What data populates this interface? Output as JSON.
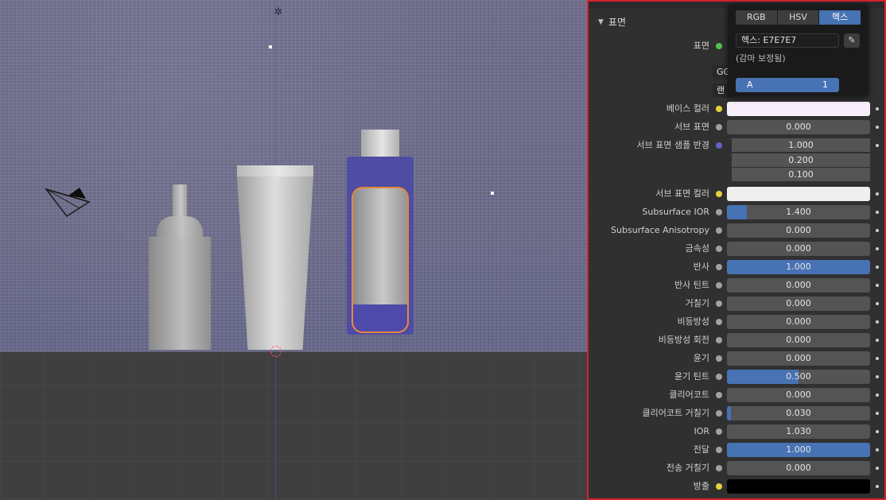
{
  "panel": {
    "section_title": "표면",
    "surface_label": "표면",
    "dropdown1_text": "GG",
    "dropdown2_text": "랜"
  },
  "picker": {
    "modes": [
      "RGB",
      "HSV",
      "헥스"
    ],
    "active_mode": "헥스",
    "hex_text": "헥스: E7E7E7",
    "gamma_note": "(감마 보정됨)",
    "alpha_label": "A",
    "alpha_value": "1"
  },
  "properties": [
    {
      "label": "베이스 컬러",
      "type": "color",
      "color": "#f7eefb",
      "socket": "yellow"
    },
    {
      "label": "서브 표면",
      "type": "value",
      "value": "0.000",
      "fill": 0,
      "socket": "grey"
    },
    {
      "label": "서브 표면 샘플 반경",
      "type": "vector",
      "values": [
        "1.000",
        "0.200",
        "0.100"
      ],
      "socket": "purple"
    },
    {
      "label": "서브 표면 컬러",
      "type": "color",
      "color": "#efefef",
      "socket": "yellow"
    },
    {
      "label": "Subsurface IOR",
      "type": "value",
      "value": "1.400",
      "fill": 0.14,
      "socket": "grey"
    },
    {
      "label": "Subsurface Anisotropy",
      "type": "value",
      "value": "0.000",
      "fill": 0,
      "socket": "grey"
    },
    {
      "label": "금속성",
      "type": "value",
      "value": "0.000",
      "fill": 0,
      "socket": "grey"
    },
    {
      "label": "반사",
      "type": "value",
      "value": "1.000",
      "fill": 1,
      "socket": "grey"
    },
    {
      "label": "반사 틴트",
      "type": "value",
      "value": "0.000",
      "fill": 0,
      "socket": "grey"
    },
    {
      "label": "거칠기",
      "type": "value",
      "value": "0.000",
      "fill": 0,
      "socket": "grey"
    },
    {
      "label": "비등방성",
      "type": "value",
      "value": "0.000",
      "fill": 0,
      "socket": "grey"
    },
    {
      "label": "비등방성 회전",
      "type": "value",
      "value": "0.000",
      "fill": 0,
      "socket": "grey"
    },
    {
      "label": "윤기",
      "type": "value",
      "value": "0.000",
      "fill": 0,
      "socket": "grey"
    },
    {
      "label": "윤기 틴트",
      "type": "value",
      "value": "0.500",
      "fill": 0.5,
      "socket": "grey"
    },
    {
      "label": "클리어코트",
      "type": "value",
      "value": "0.000",
      "fill": 0,
      "socket": "grey"
    },
    {
      "label": "클리어코트 거칠기",
      "type": "value",
      "value": "0.030",
      "fill": 0.03,
      "socket": "grey"
    },
    {
      "label": "IOR",
      "type": "value",
      "value": "1.030",
      "fill": 0,
      "socket": "grey"
    },
    {
      "label": "전달",
      "type": "value",
      "value": "1.000",
      "fill": 1,
      "socket": "grey"
    },
    {
      "label": "전송 거칠기",
      "type": "value",
      "value": "0.000",
      "fill": 0,
      "socket": "grey"
    },
    {
      "label": "방출",
      "type": "color",
      "color": "#000000",
      "socket": "yellow"
    }
  ],
  "colors": {
    "accent": "#4772b3",
    "selection_outline": "#e8883c",
    "panel_border": "#d4232d"
  }
}
